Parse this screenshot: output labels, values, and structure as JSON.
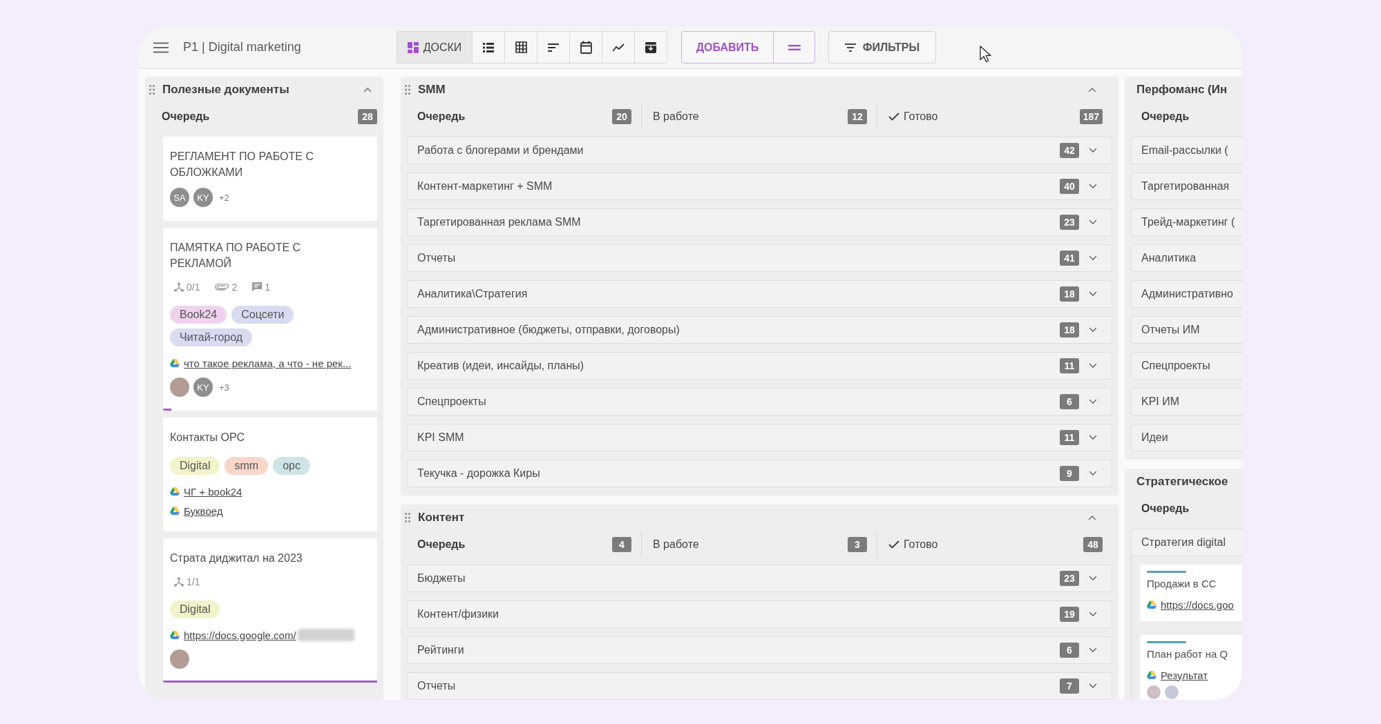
{
  "toolbar": {
    "title": "P1 | Digital marketing",
    "views": [
      {
        "kind": "boards",
        "label": "ДОСКИ",
        "selected": true
      },
      {
        "kind": "list",
        "selected": false
      },
      {
        "kind": "table",
        "selected": false
      },
      {
        "kind": "sort",
        "selected": false
      },
      {
        "kind": "calendar",
        "selected": false
      },
      {
        "kind": "chart",
        "selected": false
      },
      {
        "kind": "archive",
        "selected": false
      }
    ],
    "add_button": {
      "label": "ДОБАВИТЬ"
    },
    "filters_button": {
      "label": "ФИЛЬТРЫ"
    }
  },
  "columns": [
    {
      "panels": [
        {
          "title": "Полезные документы",
          "expanded": true,
          "statuses": [
            {
              "kind": "queue",
              "label": "Очередь",
              "count": "28"
            }
          ],
          "cards": [
            {
              "title": "РЕГЛАМЕНТ ПО РАБОТЕ С ОБЛОЖКАМИ",
              "avatars": [
                {
                  "kind": "initials",
                  "text": "SA"
                },
                {
                  "kind": "initials",
                  "text": "KY"
                }
              ],
              "more": "+2"
            },
            {
              "title": "ПАМЯТКА ПО РАБОТЕ С РЕКЛАМОЙ",
              "meta": [
                {
                  "kind": "subtasks",
                  "text": "0/1"
                },
                {
                  "kind": "attachments",
                  "text": "2"
                },
                {
                  "kind": "comments",
                  "text": "1"
                }
              ],
              "tags": [
                {
                  "label": "Book24",
                  "color": "#efd3ee"
                },
                {
                  "label": "Соцсети",
                  "color": "#d8dbf1"
                },
                {
                  "label": "Читай-город",
                  "color": "#d8dbf1"
                }
              ],
              "links": [
                {
                  "text": "что такое реклама, а что - не рек...",
                  "redacted": false
                }
              ],
              "avatars": [
                {
                  "kind": "photo"
                },
                {
                  "kind": "initials",
                  "text": "KY"
                }
              ],
              "more": "+3",
              "progress": {
                "level": 0.04
              }
            },
            {
              "title": "Контакты ОРС",
              "tags": [
                {
                  "label": "Digital",
                  "color": "#f3f3cb"
                },
                {
                  "label": "smm",
                  "color": "#f8d7c9"
                },
                {
                  "label": "орс",
                  "color": "#cfe4e7"
                }
              ],
              "links": [
                {
                  "text": "ЧГ + book24",
                  "redacted": false
                },
                {
                  "text": "Буквоед",
                  "redacted": false
                }
              ]
            },
            {
              "title": "Страта диджитал на 2023",
              "meta": [
                {
                  "kind": "subtasks",
                  "text": "1/1"
                }
              ],
              "tags": [
                {
                  "label": "Digital",
                  "color": "#f3f3cb"
                }
              ],
              "links": [
                {
                  "text": "https://docs.google.com/",
                  "redacted": true
                }
              ],
              "avatars": [
                {
                  "kind": "photo"
                }
              ],
              "progress": {
                "level": 1
              }
            }
          ]
        }
      ]
    },
    {
      "panels": [
        {
          "title": "SMM",
          "expanded": true,
          "statuses": [
            {
              "kind": "queue",
              "label": "Очередь",
              "count": "20"
            },
            {
              "kind": "in_progress",
              "label": "В работе",
              "count": "12"
            },
            {
              "kind": "done",
              "label": "Готово",
              "count": "187"
            }
          ],
          "lanes": [
            {
              "title": "Работа с блогерами и брендами",
              "count": "42",
              "expanded": false
            },
            {
              "title": "Контент-маркетинг + SMM",
              "count": "40",
              "expanded": false
            },
            {
              "title": "Таргетированная реклама SMM",
              "count": "23",
              "expanded": false
            },
            {
              "title": "Отчеты",
              "count": "41",
              "expanded": false
            },
            {
              "title": "Аналитика\\Стратегия",
              "count": "18",
              "expanded": false
            },
            {
              "title": "Административное (бюджеты, отправки, договоры)",
              "count": "18",
              "expanded": false
            },
            {
              "title": "Креатив (идеи, инсайды, планы)",
              "count": "11",
              "expanded": false
            },
            {
              "title": "Спецпроекты",
              "count": "6",
              "expanded": false
            },
            {
              "title": "KPI SMM",
              "count": "11",
              "expanded": false
            },
            {
              "title": "Текучка - дорожка Киры",
              "count": "9",
              "expanded": false
            }
          ]
        },
        {
          "title": "Контент",
          "expanded": true,
          "statuses": [
            {
              "kind": "queue",
              "label": "Очередь",
              "count": "4"
            },
            {
              "kind": "in_progress",
              "label": "В работе",
              "count": "3"
            },
            {
              "kind": "done",
              "label": "Готово",
              "count": "48"
            }
          ],
          "lanes": [
            {
              "title": "Бюджеты",
              "count": "23",
              "expanded": false
            },
            {
              "title": "Контент/физики",
              "count": "19",
              "expanded": false
            },
            {
              "title": "Рейтинги",
              "count": "6",
              "expanded": false
            },
            {
              "title": "Отчеты",
              "count": "7",
              "expanded": false
            }
          ]
        }
      ]
    },
    {
      "panels": [
        {
          "title": "Перфоманс (Ин",
          "statuses": [
            {
              "kind": "queue",
              "label": "Очередь"
            }
          ],
          "lanes": [
            {
              "title": "Email-рассылки ("
            },
            {
              "title": "Таргетированная"
            },
            {
              "title": "Трейд-маркетинг ("
            },
            {
              "title": "Аналитика"
            },
            {
              "title": "Административно"
            },
            {
              "title": "Отчеты ИМ"
            },
            {
              "title": "Спецпроекты"
            },
            {
              "title": "KPI ИМ"
            },
            {
              "title": "Идеи"
            }
          ]
        },
        {
          "title": "Стратегическое",
          "statuses": [
            {
              "kind": "queue",
              "label": "Очередь"
            }
          ],
          "lanes": [
            {
              "title": "Стратегия digital",
              "cards": [
                {
                  "title": "Продажи в СС",
                  "color": "#4fa3a5",
                  "links": [
                    {
                      "text": "https://docs.goo",
                      "redacted": false
                    }
                  ]
                },
                {
                  "title": "План работ на Q",
                  "color": "#4fa3a5",
                  "links": [
                    {
                      "text": "Результат",
                      "redacted": false
                    }
                  ],
                  "avatars": [
                    {
                      "kind": "photo"
                    },
                    {
                      "kind": "photo"
                    }
                  ]
                }
              ]
            }
          ]
        }
      ]
    }
  ]
}
